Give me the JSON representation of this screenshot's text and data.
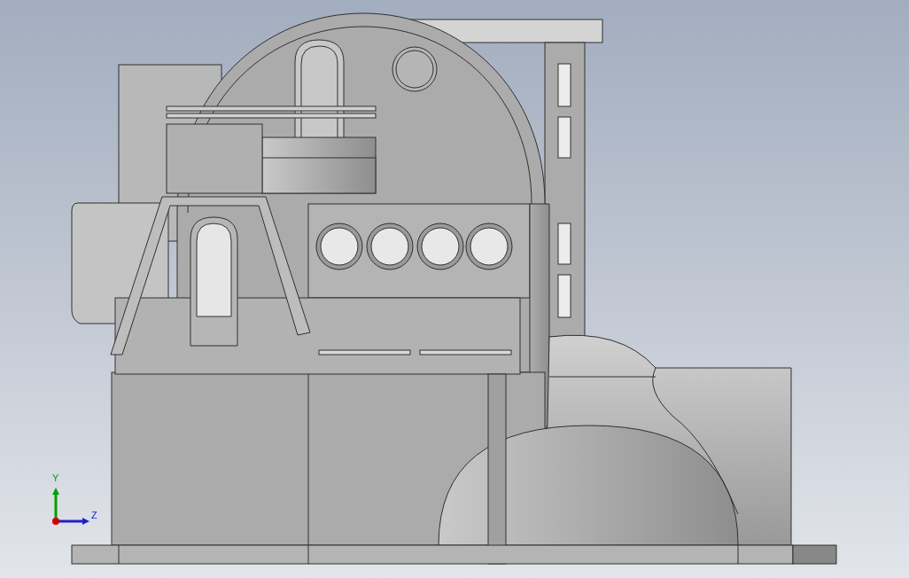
{
  "triad": {
    "axes": [
      {
        "label": "Y",
        "color": "#00a000"
      },
      {
        "label": "Z",
        "color": "#2020c8"
      }
    ]
  }
}
